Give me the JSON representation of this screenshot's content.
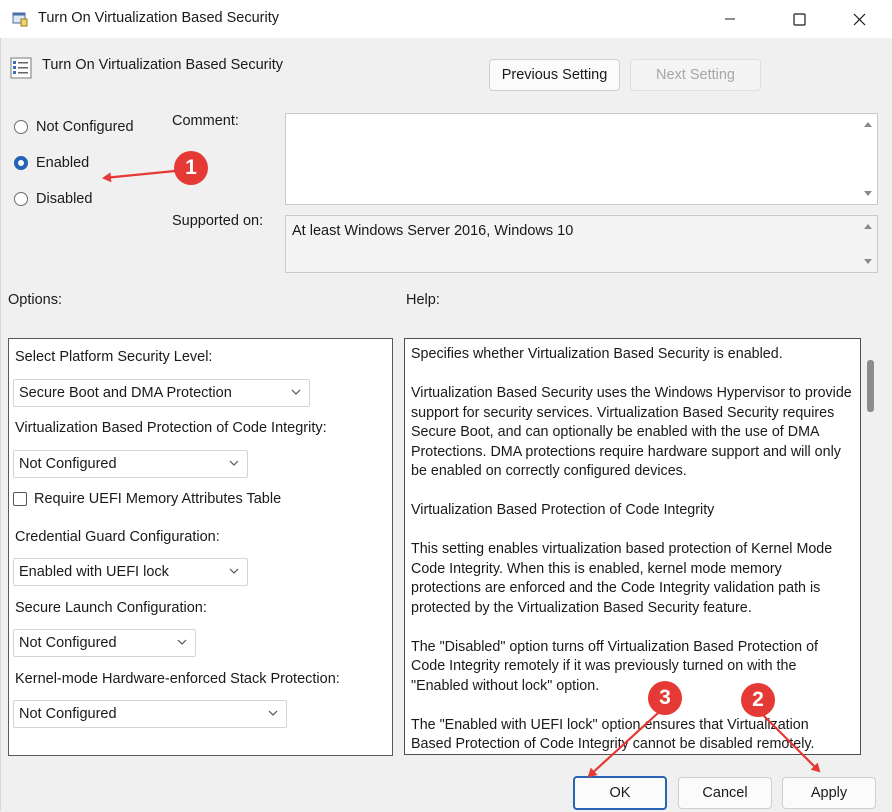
{
  "window": {
    "title": "Turn On Virtualization Based Security",
    "icon": "policy-window-icon",
    "controls": [
      "minimize-icon",
      "maximize-icon",
      "close-icon"
    ]
  },
  "header": {
    "policy_title": "Turn On Virtualization Based Security",
    "previous_button": "Previous Setting",
    "next_button": "Next Setting"
  },
  "state": {
    "options": [
      {
        "label": "Not Configured",
        "checked": false
      },
      {
        "label": "Enabled",
        "checked": true
      },
      {
        "label": "Disabled",
        "checked": false
      }
    ]
  },
  "comment": {
    "label": "Comment:",
    "value": ""
  },
  "supported": {
    "label": "Supported on:",
    "value": "At least Windows Server 2016, Windows 10"
  },
  "options_label": "Options:",
  "help_label": "Help:",
  "options": {
    "platform_label": "Select Platform Security Level:",
    "platform_value": "Secure Boot and DMA Protection",
    "vbs_ci_label": "Virtualization Based Protection of Code Integrity:",
    "vbs_ci_value": "Not Configured",
    "uefi_checkbox_label": "Require UEFI Memory Attributes Table",
    "uefi_checked": false,
    "credguard_label": "Credential Guard Configuration:",
    "credguard_value": "Enabled with UEFI lock",
    "securelaunch_label": "Secure Launch Configuration:",
    "securelaunch_value": "Not Configured",
    "stackprot_label": "Kernel-mode Hardware-enforced Stack Protection:",
    "stackprot_value": "Not Configured"
  },
  "help": {
    "paragraphs": [
      "Specifies whether Virtualization Based Security is enabled.",
      "Virtualization Based Security uses the Windows Hypervisor to provide support for security services. Virtualization Based Security requires Secure Boot, and can optionally be enabled with the use of DMA Protections. DMA protections require hardware support and will only be enabled on correctly configured devices.",
      "Virtualization Based Protection of Code Integrity",
      "This setting enables virtualization based protection of Kernel Mode Code Integrity. When this is enabled, kernel mode memory protections are enforced and the Code Integrity validation path is protected by the Virtualization Based Security feature.",
      "The \"Disabled\" option turns off Virtualization Based Protection of Code Integrity remotely if it was previously turned on with the \"Enabled without lock\" option.",
      "The \"Enabled with UEFI lock\" option ensures that Virtualization Based Protection of Code Integrity cannot be disabled remotely."
    ]
  },
  "footer": {
    "ok": "OK",
    "cancel": "Cancel",
    "apply": "Apply"
  },
  "annotations": {
    "badge1": "1",
    "badge2": "2",
    "badge3": "3",
    "color": "#e53935"
  }
}
